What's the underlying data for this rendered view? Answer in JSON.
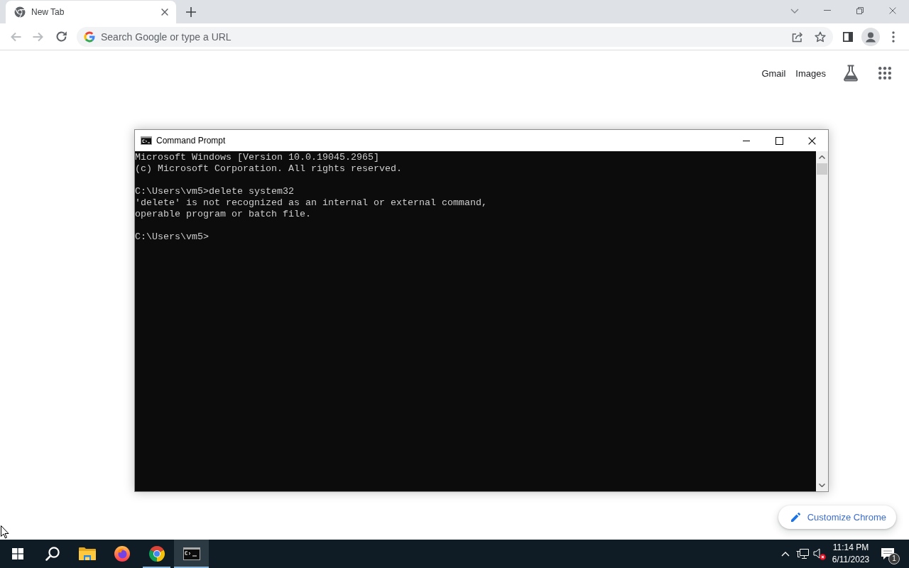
{
  "browser": {
    "tabs": [
      {
        "title": "New Tab",
        "selected": true
      }
    ],
    "toolbar": {
      "back_disabled": true,
      "forward_disabled": true
    },
    "omnibox": {
      "placeholder": "Search Google or type a URL"
    },
    "header_links": [
      "Gmail",
      "Images"
    ],
    "customize_button": "Customize Chrome"
  },
  "console_window": {
    "title": "Command Prompt",
    "output_blocks": [
      [
        "Microsoft Windows [Version 10.0.19045.2965]",
        "(c) Microsoft Corporation. All rights reserved."
      ],
      [
        "C:\\Users\\vm5>delete system32",
        "'delete' is not recognized as an internal or external command,",
        "operable program or batch file."
      ],
      [
        "C:\\Users\\vm5>"
      ]
    ]
  },
  "taskbar": {
    "apps": [
      {
        "kind": "explorer",
        "running": false,
        "selected": false
      },
      {
        "kind": "firefox",
        "running": false,
        "selected": false
      },
      {
        "kind": "chrome",
        "running": true,
        "selected": false
      },
      {
        "kind": "terminal",
        "running": true,
        "selected": true
      }
    ],
    "tray": {
      "volume": {
        "muted": true
      },
      "time": "11:14 PM",
      "date": "6/11/2023",
      "notification_count": "1"
    }
  }
}
